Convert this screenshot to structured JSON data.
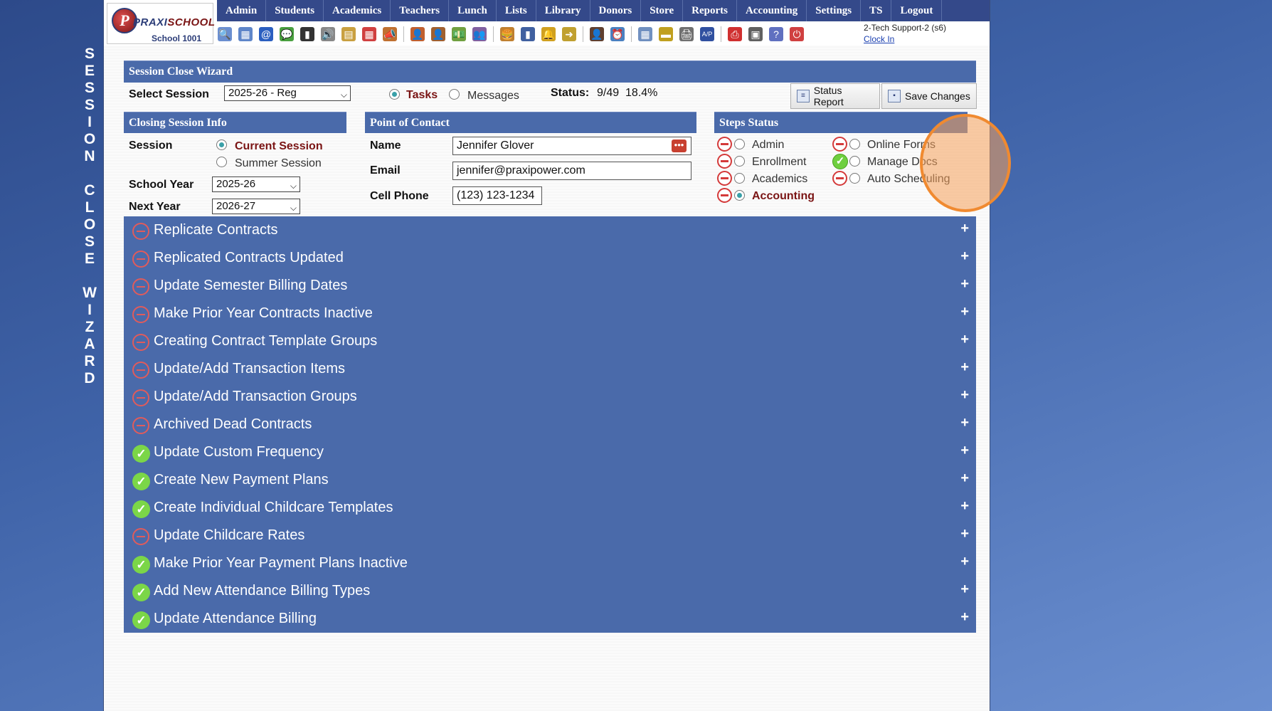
{
  "side_title": [
    "S",
    "E",
    "S",
    "S",
    "I",
    "O",
    "N",
    "",
    "C",
    "L",
    "O",
    "S",
    "E",
    "",
    "W",
    "I",
    "Z",
    "A",
    "R",
    "D"
  ],
  "logo": {
    "letter": "P",
    "brand_a": "PRAXI",
    "brand_b": "SCHOOL",
    "school": "School 1001"
  },
  "menu": [
    "Admin",
    "Students",
    "Academics",
    "Teachers",
    "Lunch",
    "Lists",
    "Library",
    "Donors",
    "Store",
    "Reports",
    "Accounting",
    "Settings",
    "TS",
    "Logout"
  ],
  "toolbar_icons": [
    {
      "name": "search-icon",
      "glyph": "🔍",
      "color": "#6b8fd0"
    },
    {
      "name": "calendar-grid-icon",
      "glyph": "▦",
      "color": "#5f86c9"
    },
    {
      "name": "at-sign-icon",
      "glyph": "@",
      "color": "#2b5fc0"
    },
    {
      "name": "chat-icon",
      "glyph": "💬",
      "color": "#4aa040"
    },
    {
      "name": "phone-icon",
      "glyph": "▮",
      "color": "#333333"
    },
    {
      "name": "speaker-icon",
      "glyph": "🔊",
      "color": "#888888"
    },
    {
      "name": "form-icon",
      "glyph": "▤",
      "color": "#c9a040"
    },
    {
      "name": "date-icon",
      "glyph": "▦",
      "color": "#d04040"
    },
    {
      "name": "megaphone-icon",
      "glyph": "📣",
      "color": "#c07030"
    },
    {
      "sep": true
    },
    {
      "name": "teacher-icon",
      "glyph": "👤",
      "color": "#c06030"
    },
    {
      "name": "staff-icon",
      "glyph": "👤",
      "color": "#a06030"
    },
    {
      "name": "money-icon",
      "glyph": "💵",
      "color": "#70a040"
    },
    {
      "name": "people-icon",
      "glyph": "👥",
      "color": "#8060a0"
    },
    {
      "sep": true
    },
    {
      "name": "lunch-icon",
      "glyph": "🍔",
      "color": "#c08030"
    },
    {
      "name": "book-icon",
      "glyph": "▮",
      "color": "#4060a0"
    },
    {
      "name": "bell-icon",
      "glyph": "🔔",
      "color": "#d0a020"
    },
    {
      "name": "export-icon",
      "glyph": "➜",
      "color": "#c0a030"
    },
    {
      "sep": true
    },
    {
      "name": "user-tie-icon",
      "glyph": "👤",
      "color": "#604030"
    },
    {
      "name": "clock-icon",
      "glyph": "⏰",
      "color": "#4a80c0"
    },
    {
      "sep": true
    },
    {
      "name": "table-icon",
      "glyph": "▦",
      "color": "#7090c0"
    },
    {
      "name": "card-icon",
      "glyph": "▬",
      "color": "#c0a020"
    },
    {
      "name": "printer-icon",
      "glyph": "🖨",
      "color": "#707070"
    },
    {
      "name": "ap-icon",
      "glyph": "A/P",
      "color": "#3050a0"
    },
    {
      "sep": true
    },
    {
      "name": "pdf-icon",
      "glyph": "⎙",
      "color": "#d03030"
    },
    {
      "name": "cash-register-icon",
      "glyph": "▣",
      "color": "#606060"
    },
    {
      "name": "help-icon",
      "glyph": "?",
      "color": "#6070c0"
    },
    {
      "name": "power-icon",
      "glyph": "⏻",
      "color": "#d04040"
    }
  ],
  "user": {
    "name": "2-Tech Support-2 (s6)",
    "clock_in": "Clock In"
  },
  "wizard": {
    "title": "Session Close Wizard",
    "select_session_label": "Select Session",
    "select_session_value": "2025-26 - Reg",
    "tasks_label": "Tasks",
    "messages_label": "Messages",
    "status_label": "Status:",
    "status_value": "9/49  18.4%",
    "status_report_button": "Status Report",
    "save_changes_button": "Save Changes"
  },
  "closing_info": {
    "title": "Closing Session Info",
    "session_label": "Session",
    "current_session": "Current Session",
    "summer_session": "Summer Session",
    "school_year_label": "School Year",
    "school_year_value": "2025-26",
    "next_year_label": "Next Year",
    "next_year_value": "2026-27"
  },
  "contact": {
    "title": "Point of Contact",
    "name_label": "Name",
    "name_value": "Jennifer Glover",
    "email_label": "Email",
    "email_value": "jennifer@praxipower.com",
    "phone_label": "Cell Phone",
    "phone_value": "(123) 123-1234"
  },
  "steps_status": {
    "title": "Steps Status",
    "left": [
      {
        "label": "Admin",
        "status": "incomplete",
        "selected": false
      },
      {
        "label": "Enrollment",
        "status": "incomplete",
        "selected": false
      },
      {
        "label": "Academics",
        "status": "incomplete",
        "selected": false
      },
      {
        "label": "Accounting",
        "status": "incomplete",
        "selected": true
      }
    ],
    "right": [
      {
        "label": "Online Forms",
        "status": "incomplete"
      },
      {
        "label": "Manage Docs",
        "status": "complete"
      },
      {
        "label": "Auto Scheduling",
        "status": "incomplete"
      }
    ]
  },
  "steps": [
    {
      "name": "Replicate Contracts",
      "done": false
    },
    {
      "name": "Replicated Contracts Updated",
      "done": false
    },
    {
      "name": "Update Semester Billing Dates",
      "done": false
    },
    {
      "name": "Make Prior Year Contracts Inactive",
      "done": false
    },
    {
      "name": "Creating Contract Template Groups",
      "done": false
    },
    {
      "name": "Update/Add Transaction Items",
      "done": false
    },
    {
      "name": "Update/Add Transaction Groups",
      "done": false
    },
    {
      "name": "Archived Dead Contracts",
      "done": false
    },
    {
      "name": "Update Custom Frequency",
      "done": true
    },
    {
      "name": "Create New Payment Plans",
      "done": true
    },
    {
      "name": "Create Individual Childcare Templates",
      "done": true
    },
    {
      "name": "Update Childcare Rates",
      "done": false
    },
    {
      "name": "Make Prior Year Payment Plans Inactive",
      "done": true
    },
    {
      "name": "Add New Attendance Billing Types",
      "done": true
    },
    {
      "name": "Update Attendance Billing",
      "done": true
    }
  ],
  "plus_glyph": "+",
  "colors": {
    "header_bar": "#4a6aaa",
    "menu_bar": "#34498a",
    "accent_red": "#7a1414",
    "check_green": "#7bd648",
    "dash_red": "#e15b5b",
    "highlight": "#f08a30"
  }
}
